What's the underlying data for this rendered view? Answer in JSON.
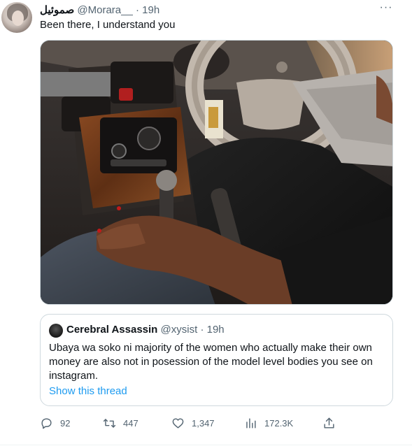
{
  "tweet": {
    "author_name": "صموئيل",
    "author_handle": "@Morara__",
    "separator": "·",
    "time": "19h",
    "more_label": "···",
    "text": "Been there, I understand you"
  },
  "quote": {
    "author_name": "Cerebral Assassin",
    "author_handle": "@xysist",
    "separator": "·",
    "time": "19h",
    "text": "Ubaya wa soko ni majority of the women who actually make their own money are also not in posession of the model level bodies you see on instagram.",
    "show_thread": "Show this thread"
  },
  "actions": {
    "replies": "92",
    "retweets": "447",
    "likes": "1,347",
    "views": "172.3K"
  },
  "icons": {
    "reply": "reply-icon",
    "retweet": "retweet-icon",
    "like": "heart-icon",
    "views": "views-icon",
    "share": "share-icon"
  },
  "colors": {
    "link": "#1d9bf0",
    "secondary_text": "#536471",
    "border": "#cfd9de"
  }
}
